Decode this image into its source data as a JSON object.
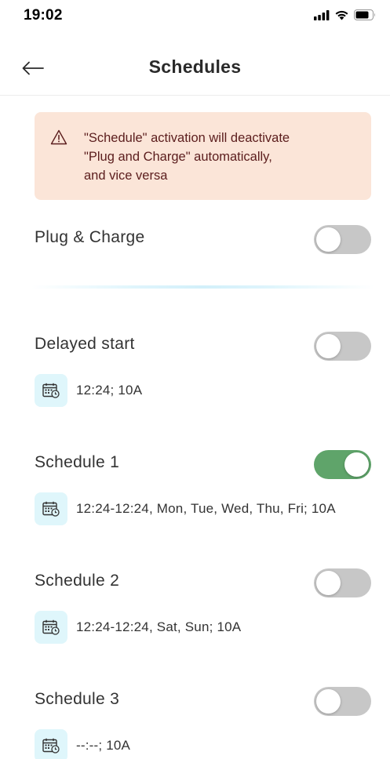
{
  "status_bar": {
    "time": "19:02"
  },
  "header": {
    "title": "Schedules",
    "back_icon": "arrow-left-icon"
  },
  "warning": {
    "icon": "warning-triangle-icon",
    "text": "\"Schedule\" activation will deactivate\n\"Plug and Charge\" automatically,\nand vice versa"
  },
  "plug_charge": {
    "label": "Plug & Charge",
    "enabled": false
  },
  "schedules": [
    {
      "label": "Delayed start",
      "enabled": false,
      "detail": "12:24; 10A"
    },
    {
      "label": "Schedule 1",
      "enabled": true,
      "detail": "12:24-12:24, Mon, Tue, Wed, Thu, Fri; 10A"
    },
    {
      "label": "Schedule 2",
      "enabled": false,
      "detail": "12:24-12:24, Sat, Sun; 10A"
    },
    {
      "label": "Schedule 3",
      "enabled": false,
      "detail": "--:--; 10A"
    }
  ],
  "colors": {
    "toggle_on": "#5fa46a",
    "toggle_off": "#c7c7c7",
    "warning_bg": "#fbe5d8",
    "warning_text": "#5b1d1d",
    "icon_badge_bg": "#dff6fb"
  }
}
